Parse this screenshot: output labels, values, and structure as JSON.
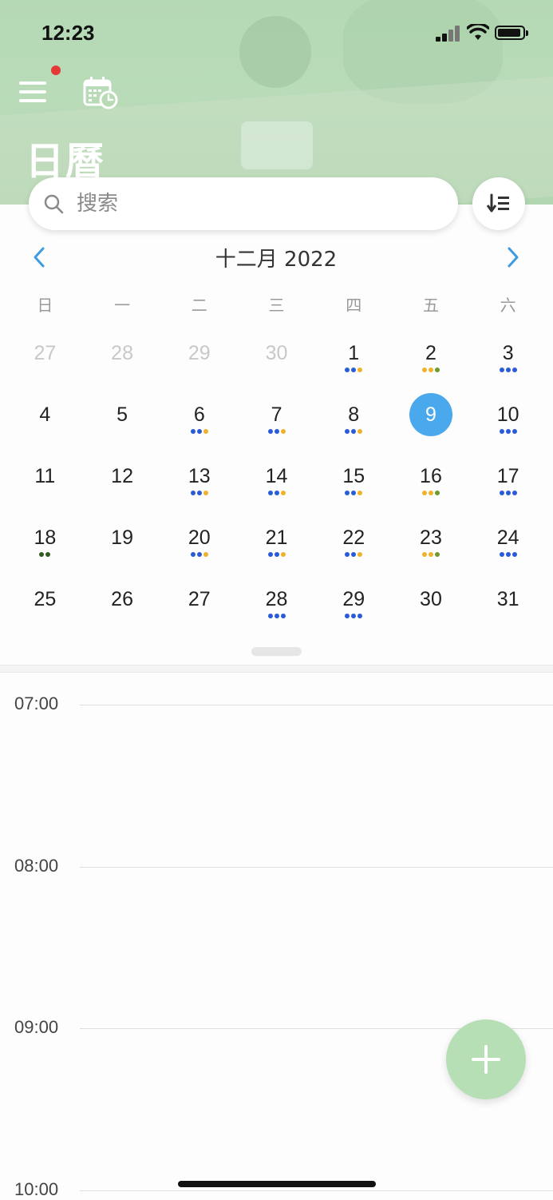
{
  "status_bar": {
    "time": "12:23"
  },
  "header": {
    "title": "日曆"
  },
  "search": {
    "placeholder": "搜索"
  },
  "calendar": {
    "month_label": "十二月 2022",
    "weekdays": [
      "日",
      "一",
      "二",
      "三",
      "四",
      "五",
      "六"
    ],
    "selected_day": "9",
    "weeks": [
      [
        {
          "label": "27",
          "other": true,
          "dots": []
        },
        {
          "label": "28",
          "other": true,
          "dots": []
        },
        {
          "label": "29",
          "other": true,
          "dots": []
        },
        {
          "label": "30",
          "other": true,
          "dots": []
        },
        {
          "label": "1",
          "dots": [
            "blue",
            "blue",
            "orange"
          ]
        },
        {
          "label": "2",
          "dots": [
            "orange",
            "orange",
            "green"
          ]
        },
        {
          "label": "3",
          "dots": [
            "blue",
            "blue",
            "blue"
          ]
        }
      ],
      [
        {
          "label": "4",
          "dots": []
        },
        {
          "label": "5",
          "dots": []
        },
        {
          "label": "6",
          "dots": [
            "blue",
            "blue",
            "orange"
          ]
        },
        {
          "label": "7",
          "dots": [
            "blue",
            "blue",
            "orange"
          ]
        },
        {
          "label": "8",
          "dots": [
            "blue",
            "blue",
            "orange"
          ]
        },
        {
          "label": "9",
          "selected": true,
          "dots": []
        },
        {
          "label": "10",
          "dots": [
            "blue",
            "blue",
            "blue"
          ]
        }
      ],
      [
        {
          "label": "11",
          "dots": []
        },
        {
          "label": "12",
          "dots": []
        },
        {
          "label": "13",
          "dots": [
            "blue",
            "blue",
            "orange"
          ]
        },
        {
          "label": "14",
          "dots": [
            "blue",
            "blue",
            "orange"
          ]
        },
        {
          "label": "15",
          "dots": [
            "blue",
            "blue",
            "orange"
          ]
        },
        {
          "label": "16",
          "dots": [
            "orange",
            "orange",
            "green"
          ]
        },
        {
          "label": "17",
          "dots": [
            "blue",
            "blue",
            "blue"
          ]
        }
      ],
      [
        {
          "label": "18",
          "dots": [
            "darkgreen",
            "darkgreen"
          ]
        },
        {
          "label": "19",
          "dots": []
        },
        {
          "label": "20",
          "dots": [
            "blue",
            "blue",
            "orange"
          ]
        },
        {
          "label": "21",
          "dots": [
            "blue",
            "blue",
            "orange"
          ]
        },
        {
          "label": "22",
          "dots": [
            "blue",
            "blue",
            "orange"
          ]
        },
        {
          "label": "23",
          "dots": [
            "orange",
            "orange",
            "green"
          ]
        },
        {
          "label": "24",
          "dots": [
            "blue",
            "blue",
            "blue"
          ]
        }
      ],
      [
        {
          "label": "25",
          "dots": []
        },
        {
          "label": "26",
          "dots": []
        },
        {
          "label": "27",
          "dots": []
        },
        {
          "label": "28",
          "dots": [
            "blue",
            "blue",
            "blue"
          ]
        },
        {
          "label": "29",
          "dots": [
            "blue",
            "blue",
            "blue"
          ]
        },
        {
          "label": "30",
          "dots": []
        },
        {
          "label": "31",
          "dots": []
        }
      ]
    ]
  },
  "timeline": {
    "hours": [
      "07:00",
      "08:00",
      "09:00",
      "10:00"
    ]
  },
  "colors": {
    "accent": "#4aa8ec",
    "header_green": "#b5d9b4",
    "fab_green": "#b7dfb5",
    "dot_blue": "#2a5bd7",
    "dot_orange": "#f0b12c",
    "dot_green": "#6f9a2c",
    "dot_darkgreen": "#2f5a1e",
    "notification_red": "#e53935"
  },
  "icons": {
    "menu": "hamburger-menu-icon",
    "calendar_clock": "calendar-clock-icon",
    "search": "search-icon",
    "sort": "sort-list-icon",
    "prev": "chevron-left-icon",
    "next": "chevron-right-icon",
    "add": "plus-icon"
  }
}
